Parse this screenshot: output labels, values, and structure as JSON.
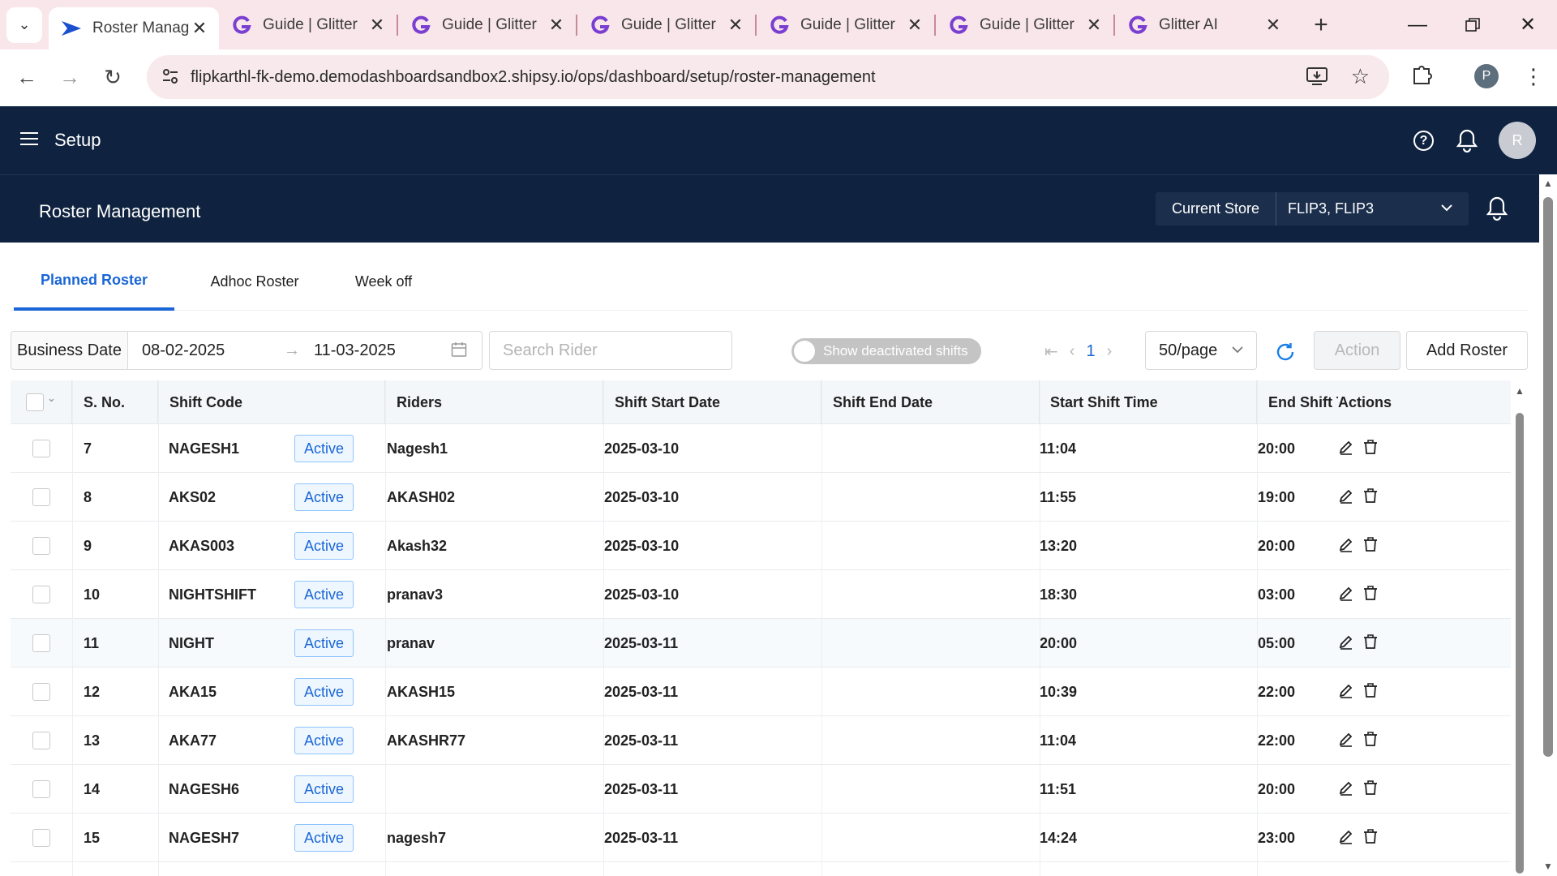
{
  "browser": {
    "tabs": [
      {
        "title": "Roster Manag",
        "active": true,
        "icon": "shipsy-logo-icon"
      },
      {
        "title": "Guide | Glitter",
        "active": false,
        "icon": "glitter-logo-icon"
      },
      {
        "title": "Guide | Glitter",
        "active": false,
        "icon": "glitter-logo-icon"
      },
      {
        "title": "Guide | Glitter",
        "active": false,
        "icon": "glitter-logo-icon"
      },
      {
        "title": "Guide | Glitter",
        "active": false,
        "icon": "glitter-logo-icon"
      },
      {
        "title": "Guide | Glitter",
        "active": false,
        "icon": "glitter-logo-icon"
      },
      {
        "title": "Glitter AI",
        "active": false,
        "icon": "glitter-logo-icon"
      }
    ],
    "url": "flipkarthl-fk-demo.demodashboardsandbox2.shipsy.io/ops/dashboard/setup/roster-management",
    "profile_initial": "P"
  },
  "app": {
    "section_title": "Setup",
    "avatar_initial": "R",
    "page_title": "Roster Management",
    "store_label": "Current Store",
    "store_value": "FLIP3, FLIP3"
  },
  "tabs": {
    "planned": "Planned Roster",
    "adhoc": "Adhoc Roster",
    "weekoff": "Week off"
  },
  "filters": {
    "business_date_label": "Business Date",
    "start_date": "08-02-2025",
    "end_date": "11-03-2025",
    "search_placeholder": "Search Rider",
    "deactivated_toggle_label": "Show deactivated shifts",
    "current_page": "1",
    "page_size": "50/page",
    "action_label": "Action",
    "add_roster_label": "Add Roster"
  },
  "table": {
    "headers": {
      "sno": "S. No.",
      "shift_code": "Shift Code",
      "riders": "Riders",
      "start_date": "Shift Start Date",
      "end_date": "Shift End Date",
      "start_time": "Start Shift Time",
      "end_time": "End Shift T",
      "actions": "Actions"
    },
    "rows": [
      {
        "sno": "7",
        "code": "NAGESH1",
        "status": "Active",
        "rider": "Nagesh1",
        "start_date": "2025-03-10",
        "end_date": "",
        "start_time": "11:04",
        "end_time": "20:00"
      },
      {
        "sno": "8",
        "code": "AKS02",
        "status": "Active",
        "rider": "AKASH02",
        "start_date": "2025-03-10",
        "end_date": "",
        "start_time": "11:55",
        "end_time": "19:00"
      },
      {
        "sno": "9",
        "code": "AKAS003",
        "status": "Active",
        "rider": "Akash32",
        "start_date": "2025-03-10",
        "end_date": "",
        "start_time": "13:20",
        "end_time": "20:00"
      },
      {
        "sno": "10",
        "code": "NIGHTSHIFT",
        "status": "Active",
        "rider": "pranav3",
        "start_date": "2025-03-10",
        "end_date": "",
        "start_time": "18:30",
        "end_time": "03:00"
      },
      {
        "sno": "11",
        "code": "NIGHT",
        "status": "Active",
        "rider": "pranav",
        "start_date": "2025-03-11",
        "end_date": "",
        "start_time": "20:00",
        "end_time": "05:00"
      },
      {
        "sno": "12",
        "code": "AKA15",
        "status": "Active",
        "rider": "AKASH15",
        "start_date": "2025-03-11",
        "end_date": "",
        "start_time": "10:39",
        "end_time": "22:00"
      },
      {
        "sno": "13",
        "code": "AKA77",
        "status": "Active",
        "rider": "AKASHR77",
        "start_date": "2025-03-11",
        "end_date": "",
        "start_time": "11:04",
        "end_time": "22:00"
      },
      {
        "sno": "14",
        "code": "NAGESH6",
        "status": "Active",
        "rider": "",
        "start_date": "2025-03-11",
        "end_date": "",
        "start_time": "11:51",
        "end_time": "20:00"
      },
      {
        "sno": "15",
        "code": "NAGESH7",
        "status": "Active",
        "rider": "nagesh7",
        "start_date": "2025-03-11",
        "end_date": "",
        "start_time": "14:24",
        "end_time": "23:00"
      }
    ]
  },
  "colors": {
    "header_bg": "#0f2340",
    "accent": "#1a66d6",
    "tabstrip_bg": "#f8e6ea"
  }
}
